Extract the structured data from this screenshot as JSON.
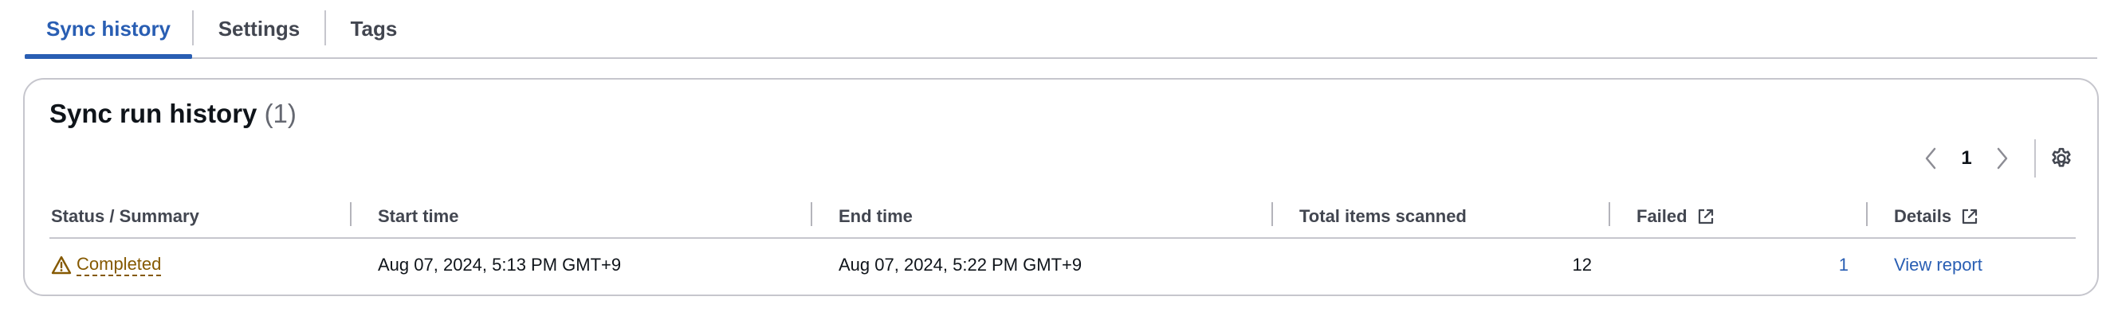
{
  "tabs": [
    {
      "label": "Sync history",
      "active": true
    },
    {
      "label": "Settings",
      "active": false
    },
    {
      "label": "Tags",
      "active": false
    }
  ],
  "panel": {
    "title": "Sync run history",
    "count": "(1)"
  },
  "pagination": {
    "current_page": "1",
    "prev_icon": "chevron-left-icon",
    "next_icon": "chevron-right-icon",
    "settings_icon": "gear-icon"
  },
  "table": {
    "columns": [
      {
        "label": "Status / Summary"
      },
      {
        "label": "Start time"
      },
      {
        "label": "End time"
      },
      {
        "label": "Total items scanned"
      },
      {
        "label": "Failed",
        "icon": "external-link-icon"
      },
      {
        "label": "Details",
        "icon": "external-link-icon"
      }
    ],
    "rows": [
      {
        "status": "Completed",
        "status_icon": "warning-icon",
        "start_time": "Aug 07, 2024, 5:13 PM GMT+9",
        "end_time": "Aug 07, 2024, 5:22 PM GMT+9",
        "total_items_scanned": "12",
        "failed": "1",
        "details": "View report"
      }
    ]
  },
  "colors": {
    "accent": "#295eb3",
    "warning": "#855900",
    "border": "#c6c6cd",
    "text": "#0f141a"
  }
}
